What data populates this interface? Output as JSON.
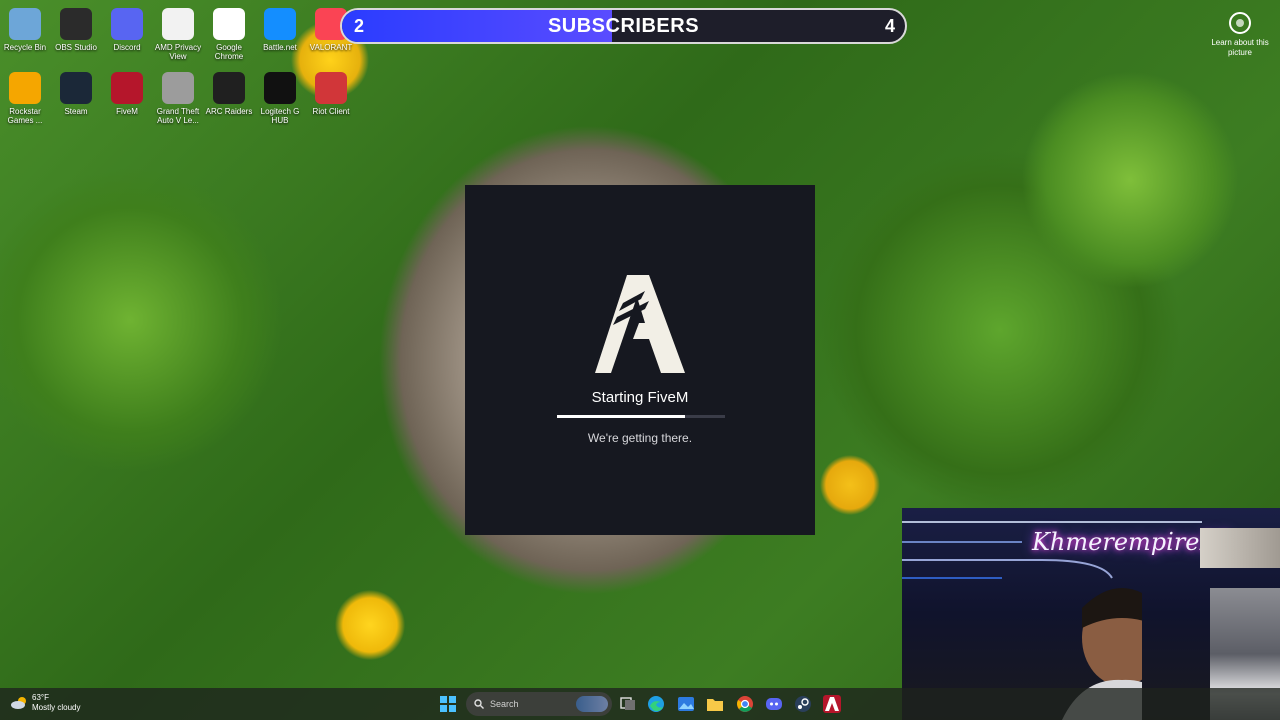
{
  "desktop": {
    "icons": [
      {
        "label": "Recycle Bin",
        "icon": "recycle-bin-icon",
        "color": "#6da6d8"
      },
      {
        "label": "OBS Studio",
        "icon": "obs-icon",
        "color": "#2b2b2b"
      },
      {
        "label": "Discord",
        "icon": "discord-icon",
        "color": "#5865f2"
      },
      {
        "label": "AMD Privacy View",
        "icon": "amd-eye-icon",
        "color": "#f2f2f2"
      },
      {
        "label": "Google Chrome",
        "icon": "chrome-icon",
        "color": "#ffffff"
      },
      {
        "label": "Battle.net",
        "icon": "battlenet-icon",
        "color": "#148eff"
      },
      {
        "label": "VALORANT",
        "icon": "valorant-icon",
        "color": "#fa4454"
      },
      {
        "label": "Rockstar Games ...",
        "icon": "rockstar-icon",
        "color": "#f5a600"
      },
      {
        "label": "Steam",
        "icon": "steam-icon",
        "color": "#1b2838"
      },
      {
        "label": "FiveM",
        "icon": "fivem-icon",
        "color": "#b5162b"
      },
      {
        "label": "Grand Theft Auto V Le...",
        "icon": "gta-icon",
        "color": "#9c9c9c"
      },
      {
        "label": "ARC Raiders",
        "icon": "arc-raiders-icon",
        "color": "#202020"
      },
      {
        "label": "Logitech G HUB",
        "icon": "logitech-icon",
        "color": "#111111"
      },
      {
        "label": "Riot Client",
        "icon": "riot-icon",
        "color": "#d13639"
      }
    ],
    "wallpaper_credit": "Learn about this picture"
  },
  "subscriber_bar": {
    "left": "2",
    "title": "SUBSCRIBERS",
    "right": "4",
    "progress": 0.48
  },
  "splash": {
    "title": "Starting FiveM",
    "subtitle": "We're getting there.",
    "progress": 0.76
  },
  "webcam": {
    "neon_sign": "Khmerempire23"
  },
  "taskbar": {
    "weather_temp": "63°F",
    "weather_desc": "Mostly cloudy",
    "search_placeholder": "Search",
    "apps": [
      "start-icon",
      "search-icon",
      "task-view-icon",
      "edge-icon",
      "photos-icon",
      "file-explorer-icon",
      "chrome-icon",
      "discord-icon",
      "steam-icon",
      "fivem-icon"
    ]
  }
}
